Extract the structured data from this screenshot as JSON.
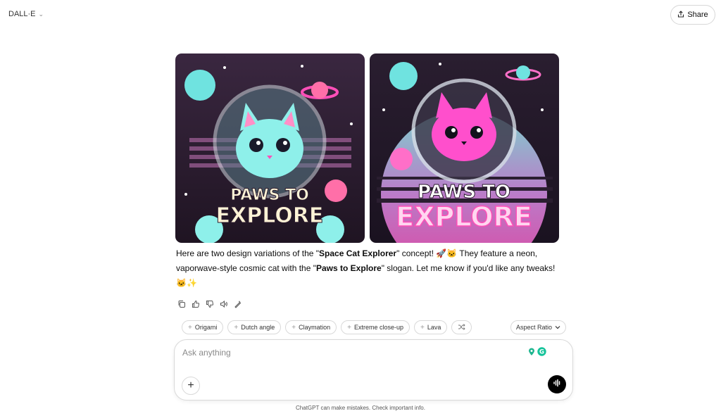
{
  "header": {
    "model_name": "DALL·E",
    "share_label": "Share"
  },
  "images": [
    {
      "caption_line1": "PAWS TO",
      "caption_line2": "EXPLORE"
    },
    {
      "caption_line1": "PAWS TO",
      "caption_line2": "EXPLORE"
    }
  ],
  "message": {
    "part1": "Here are two design variations of the \"",
    "bold1": "Space Cat Explorer",
    "part2": "\" concept! 🚀🐱 They feature a neon, vaporwave-style cosmic cat with the \"",
    "bold2": "Paws to Explore",
    "part3": "\" slogan. Let me know if you'd like any tweaks! 🐱✨"
  },
  "chips": [
    "Origami",
    "Dutch angle",
    "Claymation",
    "Extreme close-up",
    "Lava"
  ],
  "aspect_ratio_label": "Aspect Ratio",
  "composer": {
    "placeholder": "Ask anything"
  },
  "disclaimer": "ChatGPT can make mistakes. Check important info.",
  "colors": {
    "accent_pink": "#ff4fb8",
    "accent_cyan": "#6fe3e0",
    "dark_bg": "#2b1c2e"
  }
}
